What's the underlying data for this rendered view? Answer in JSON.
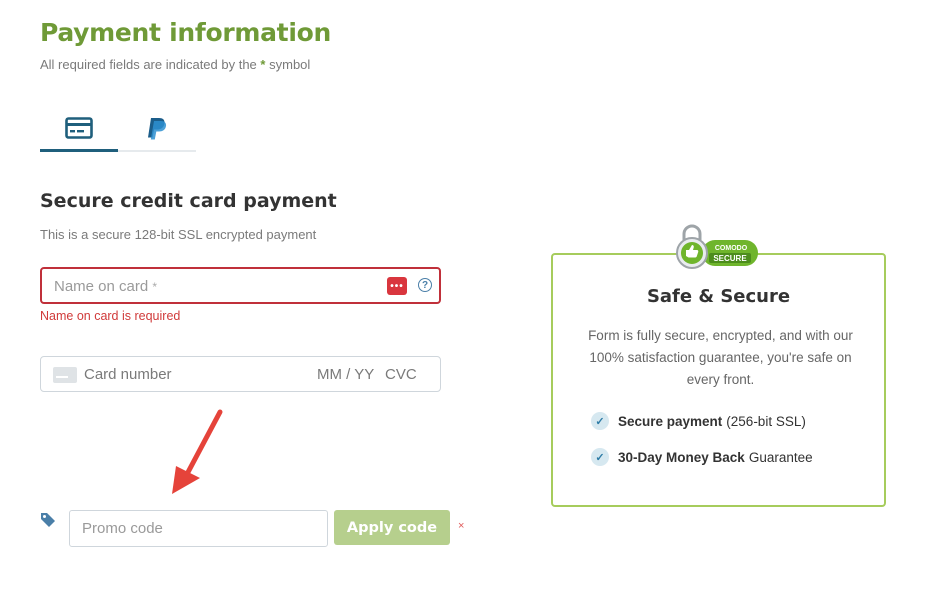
{
  "header": {
    "title": "Payment information",
    "subtitle_prefix": "All required fields are indicated by the",
    "subtitle_star": "*",
    "subtitle_suffix": "symbol"
  },
  "tabs": [
    {
      "name": "credit-card",
      "icon": "credit-card-icon",
      "active": true
    },
    {
      "name": "paypal",
      "icon": "paypal-icon",
      "active": false
    }
  ],
  "section": {
    "title": "Secure credit card payment",
    "subtitle": "This is a secure 128-bit SSL encrypted payment"
  },
  "name_field": {
    "placeholder": "Name on card",
    "required_mark": "*",
    "dots_icon": "•••",
    "help_icon": "?",
    "error": "Name on card is required"
  },
  "card_field": {
    "number_placeholder": "Card number",
    "expiry_placeholder": "MM / YY",
    "cvc_placeholder": "CVC"
  },
  "promo": {
    "placeholder": "Promo code",
    "apply_label": "Apply code",
    "close_label": "×"
  },
  "secure_box": {
    "badge_top": "COMODO",
    "badge_bottom": "SECURE",
    "title": "Safe & Secure",
    "description": "Form is fully secure, encrypted, and with our 100% satisfaction guarantee, you're safe on every front.",
    "features": [
      {
        "bold": "Secure payment",
        "rest": "(256-bit SSL)"
      },
      {
        "bold": "30-Day Money Back",
        "rest": "Guarantee"
      }
    ]
  },
  "colors": {
    "brand_green": "#6f9a37",
    "error_red": "#c0303a",
    "tab_active": "#1f5f7c",
    "button_green": "#b6cf8d",
    "arrow_red": "#e5433a"
  }
}
